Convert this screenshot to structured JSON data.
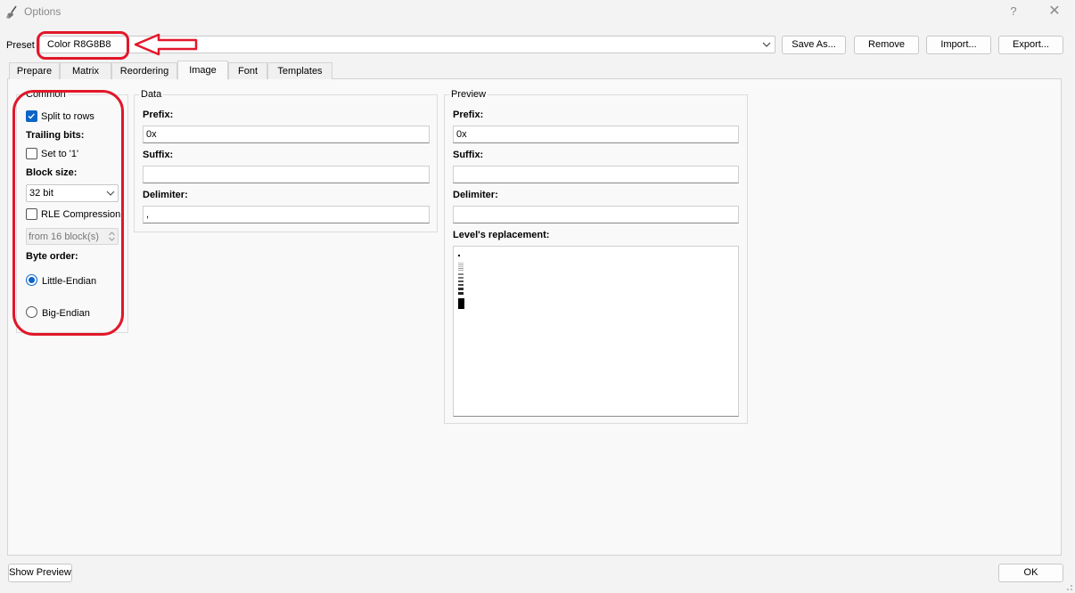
{
  "window": {
    "title": "Options",
    "help_glyph": "?",
    "close_glyph": "✕"
  },
  "preset": {
    "label": "Preset",
    "value": "Color R8G8B8",
    "buttons": {
      "save_as": "Save As...",
      "remove": "Remove",
      "import": "Import...",
      "export": "Export..."
    }
  },
  "tabs": [
    {
      "label": "Prepare"
    },
    {
      "label": "Matrix"
    },
    {
      "label": "Reordering"
    },
    {
      "label": "Image",
      "active": true
    },
    {
      "label": "Font"
    },
    {
      "label": "Templates"
    }
  ],
  "common": {
    "title": "Common",
    "split_to_rows": {
      "label": "Split to rows",
      "checked": true
    },
    "trailing_bits_label": "Trailing bits:",
    "set_to_one": {
      "label": "Set to '1'",
      "checked": false
    },
    "block_size_label": "Block size:",
    "block_size_value": "32 bit",
    "rle": {
      "label": "RLE Compression",
      "checked": false
    },
    "rle_from": "from 16 block(s)",
    "byte_order_label": "Byte order:",
    "little_endian": {
      "label": "Little-Endian",
      "checked": true
    },
    "big_endian": {
      "label": "Big-Endian",
      "checked": false
    }
  },
  "data_group": {
    "title": "Data",
    "prefix_label": "Prefix:",
    "prefix_value": "0x",
    "suffix_label": "Suffix:",
    "suffix_value": "",
    "delimiter_label": "Delimiter:",
    "delimiter_value": ","
  },
  "preview_group": {
    "title": "Preview",
    "prefix_label": "Prefix:",
    "prefix_value": "0x",
    "suffix_label": "Suffix:",
    "suffix_value": "",
    "delimiter_label": "Delimiter:",
    "delimiter_value": "",
    "levels_label": "Level's replacement:"
  },
  "footer": {
    "show_preview": "Show Preview",
    "ok": "OK"
  },
  "colors": {
    "accent": "#0a64c8",
    "annotation": "#e2172a"
  }
}
